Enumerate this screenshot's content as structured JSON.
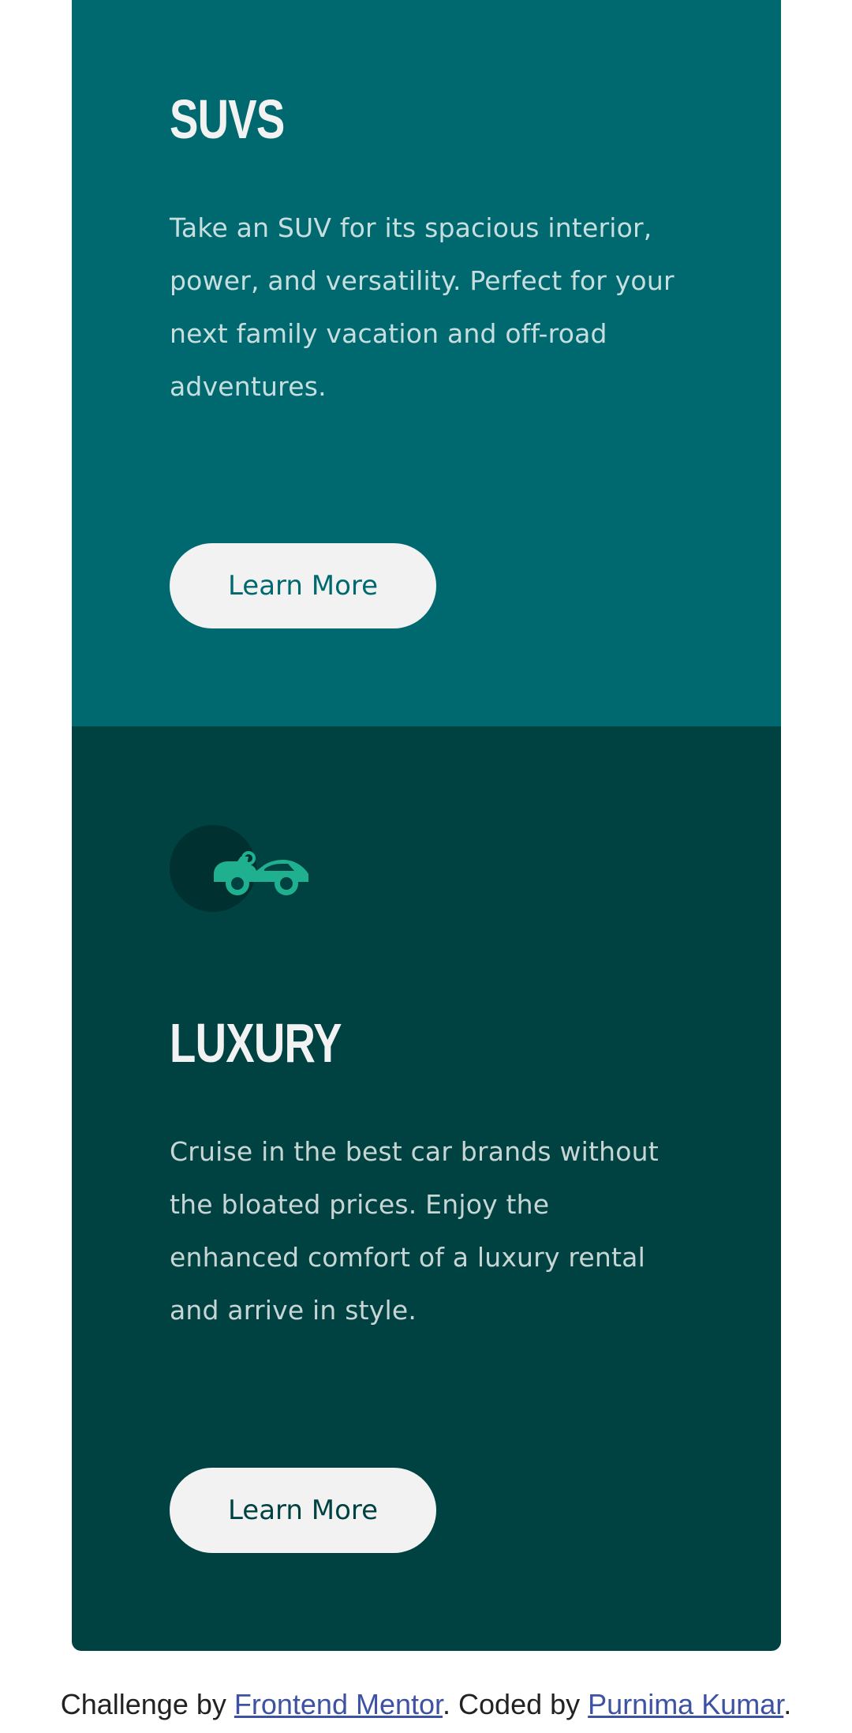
{
  "colors": {
    "suvs_bg": "#006970",
    "luxury_bg": "#004241",
    "button_bg": "#f2f2f2",
    "icon_accent": "#1fb08f",
    "footer_link": "#3e52a3"
  },
  "panels": {
    "suvs": {
      "title": "SUVS",
      "description": "Take an SUV for its spacious interior, power, and versatility. Perfect for your next family vacation and off-road adventures.",
      "button_label": "Learn More"
    },
    "luxury": {
      "icon": "luxury-car-icon",
      "title": "LUXURY",
      "description": "Cruise in the best car brands without the bloated prices. Enjoy the enhanced comfort of a luxury rental and arrive in style.",
      "button_label": "Learn More"
    }
  },
  "footer": {
    "prefix": "Challenge by ",
    "link1": "Frontend Mentor",
    "middle": ". Coded by ",
    "link2": "Purnima Kumar",
    "suffix": "."
  }
}
